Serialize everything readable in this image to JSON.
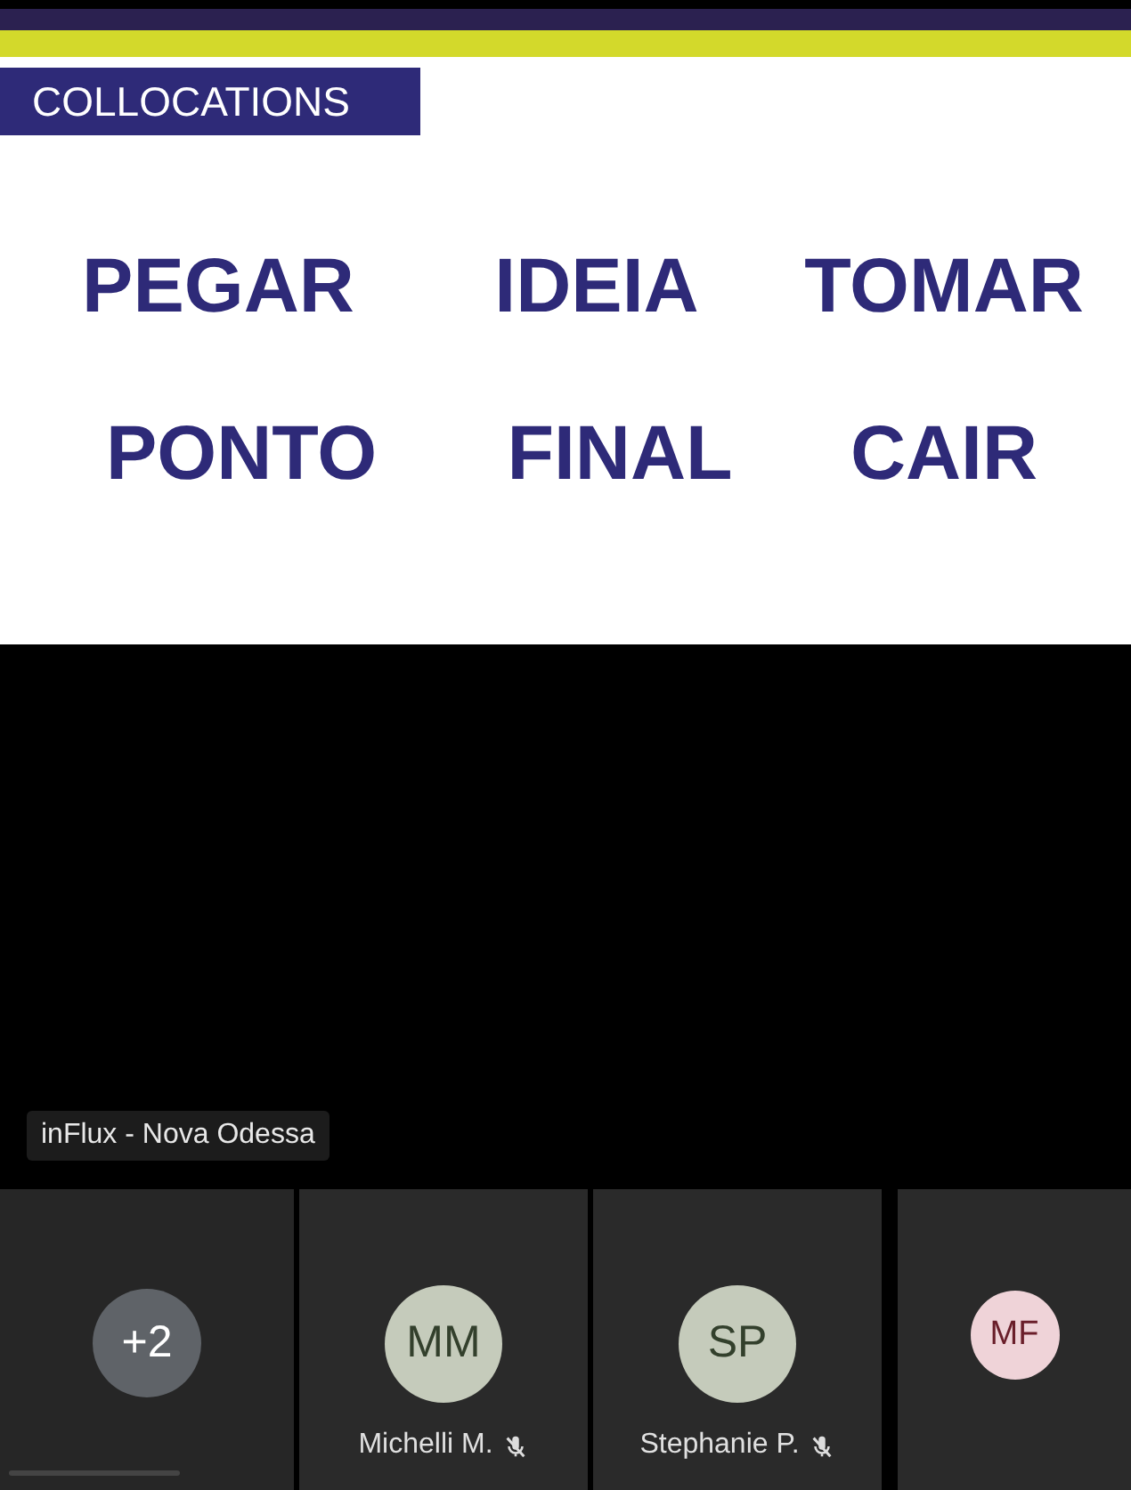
{
  "slide": {
    "title": "COLLOCATIONS",
    "words": [
      "PEGAR",
      "IDEIA",
      "TOMAR",
      "PONTO",
      "FINAL",
      "CAIR"
    ]
  },
  "presenter_label": "inFlux - Nova Odessa",
  "participants": [
    {
      "kind": "overflow",
      "initials": "+2",
      "color": "#5f6368"
    },
    {
      "kind": "person",
      "initials": "MM",
      "name": "Michelli M.",
      "muted": true,
      "color": "#c5cbbb"
    },
    {
      "kind": "person",
      "initials": "SP",
      "name": "Stephanie P.",
      "muted": true,
      "color": "#c5cbbb"
    },
    {
      "kind": "compact",
      "initials": "MF",
      "color": "#efd3d8"
    }
  ]
}
